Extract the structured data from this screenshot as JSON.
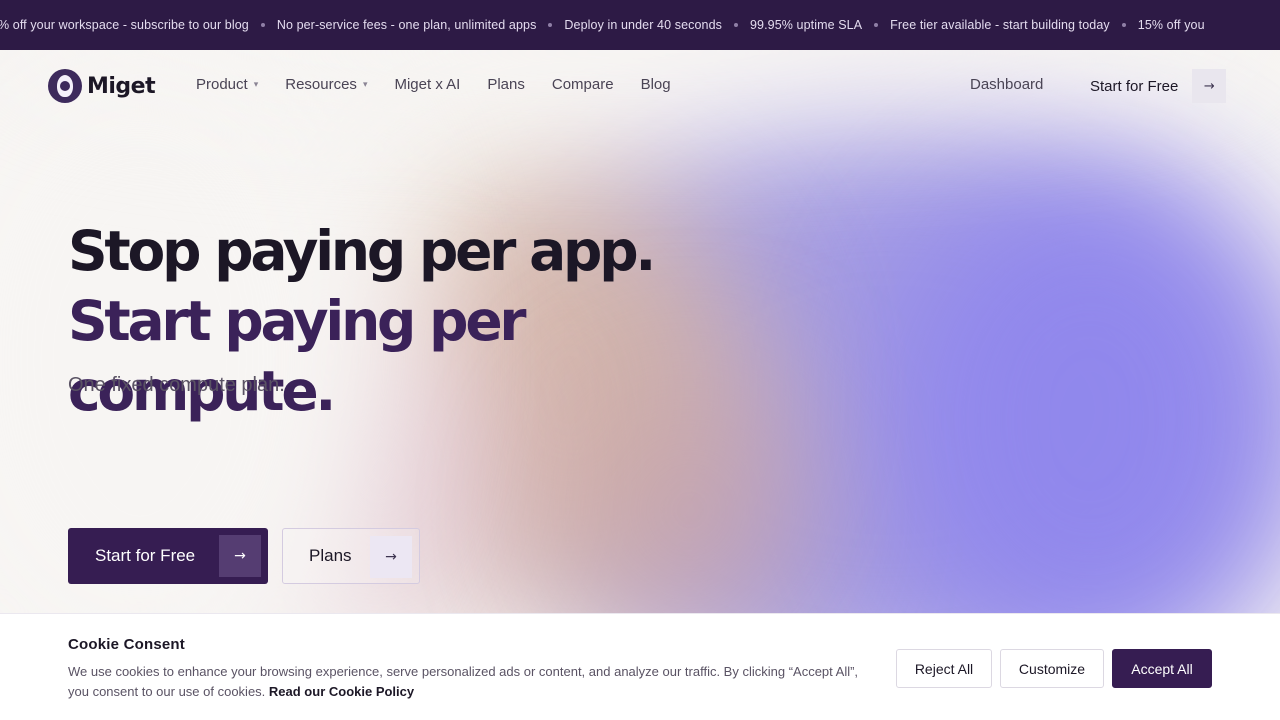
{
  "announcements": [
    "% off your workspace - subscribe to our blog",
    "No per-service fees - one plan, unlimited apps",
    "Deploy in under 40 seconds",
    "99.95% uptime SLA",
    "Free tier available - start building today",
    "15% off you"
  ],
  "brand": {
    "name": "Miget",
    "accent": "#361d52",
    "ticker_bg": "#2d1a45"
  },
  "nav": {
    "items": [
      {
        "label": "Product",
        "has_dropdown": true
      },
      {
        "label": "Resources",
        "has_dropdown": true
      },
      {
        "label": "Miget x AI",
        "has_dropdown": false
      },
      {
        "label": "Plans",
        "has_dropdown": false
      },
      {
        "label": "Compare",
        "has_dropdown": false
      },
      {
        "label": "Blog",
        "has_dropdown": false
      }
    ],
    "dashboard_label": "Dashboard",
    "cta_label": "Start for Free",
    "chevron_glyph": "⌄",
    "arrow_glyph": "→"
  },
  "hero": {
    "title_part1": "Stop paying per app. ",
    "title_part2": "Start paying per compute.",
    "subtitle": "One fixed compute plan.",
    "primary_cta": "Start for Free",
    "secondary_cta": "Plans",
    "arrow_glyph": "→"
  },
  "cookie": {
    "title": "Cookie Consent",
    "text": "We use cookies to enhance your browsing experience, serve personalized ads or content, and analyze our traffic. By clicking “Accept All”, you consent to our use of cookies. ",
    "link": "Read our Cookie Policy",
    "reject_label": "Reject All",
    "customize_label": "Customize",
    "accept_label": "Accept All"
  }
}
